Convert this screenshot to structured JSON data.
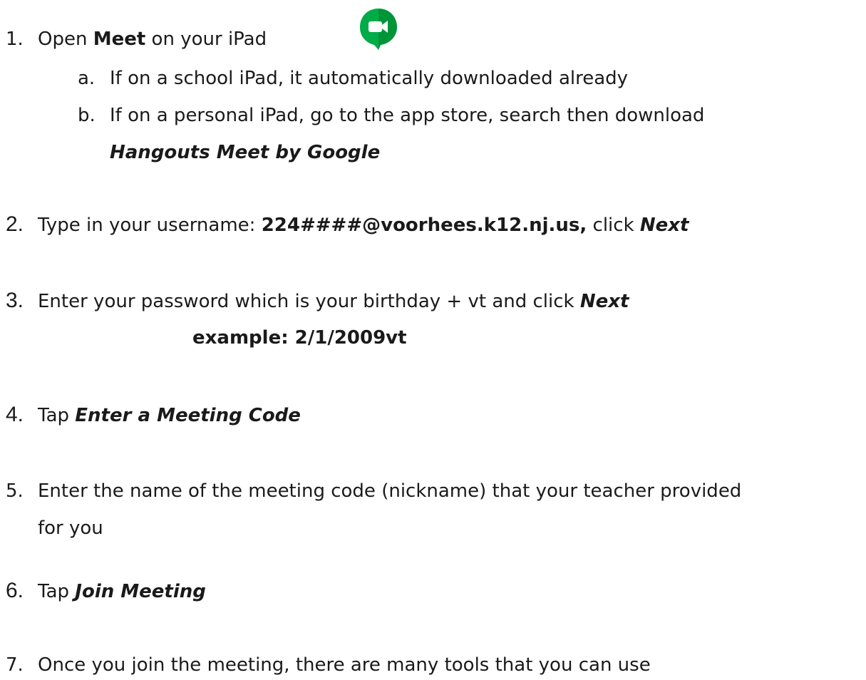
{
  "steps": [
    {
      "num": "1.",
      "pre": "Open ",
      "bold": "Meet",
      "post": " on your iPad"
    },
    {
      "sub": "a.",
      "text": "If on a school iPad, it automatically downloaded already"
    },
    {
      "sub": "b.",
      "text": "If on a personal iPad, go to the app store, search then download",
      "app": "Hangouts Meet by Google"
    },
    {
      "num": "2.",
      "pre": "Type in your username: ",
      "bold": "224####@voorhees.k12.nj.us,",
      "mid": " click ",
      "action": "Next"
    },
    {
      "num": "3.",
      "pre": "Enter your password which is your birthday + vt  and click ",
      "action": "Next",
      "example": "example: 2/1/2009vt"
    },
    {
      "num": "4.",
      "pre": "Tap ",
      "action": "Enter a Meeting Code"
    },
    {
      "num": "5.",
      "text": "Enter the name of the meeting code (nickname) that your teacher provided",
      "cont": "for you"
    },
    {
      "num": "6.",
      "pre": "Tap ",
      "action": "Join Meeting"
    },
    {
      "num": "7.",
      "text": "Once you join the meeting, there are many tools that you can use"
    }
  ],
  "icons": {
    "meet_logo": "google-meet-logo-icon"
  },
  "colors": {
    "meet_green": "#00AC47",
    "meet_dark": "#00832D"
  }
}
